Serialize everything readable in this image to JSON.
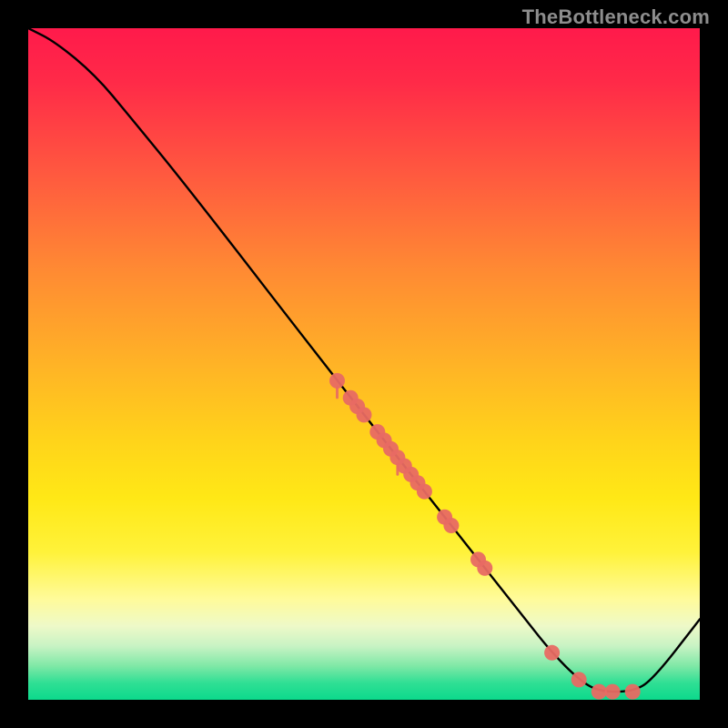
{
  "watermark": "TheBottleneck.com",
  "chart_data": {
    "type": "line",
    "title": "",
    "xlabel": "",
    "ylabel": "",
    "xlim": [
      0,
      100
    ],
    "ylim": [
      0,
      100
    ],
    "grid": false,
    "curve": [
      {
        "x": 0,
        "y": 100
      },
      {
        "x": 4,
        "y": 98
      },
      {
        "x": 10,
        "y": 93
      },
      {
        "x": 15,
        "y": 87
      },
      {
        "x": 24,
        "y": 76
      },
      {
        "x": 46,
        "y": 47.5
      },
      {
        "x": 74,
        "y": 12
      },
      {
        "x": 78,
        "y": 7
      },
      {
        "x": 82,
        "y": 3
      },
      {
        "x": 85,
        "y": 1.2
      },
      {
        "x": 90,
        "y": 1.2
      },
      {
        "x": 93,
        "y": 3
      },
      {
        "x": 100,
        "y": 12
      }
    ],
    "markers_on_curve_x": [
      46,
      48,
      49,
      50,
      52,
      53,
      54,
      55,
      56,
      57,
      58,
      59,
      62,
      63,
      67,
      68,
      78,
      82,
      85,
      87,
      90
    ],
    "marker_color": "#e86a63",
    "curve_color": "#000000"
  }
}
